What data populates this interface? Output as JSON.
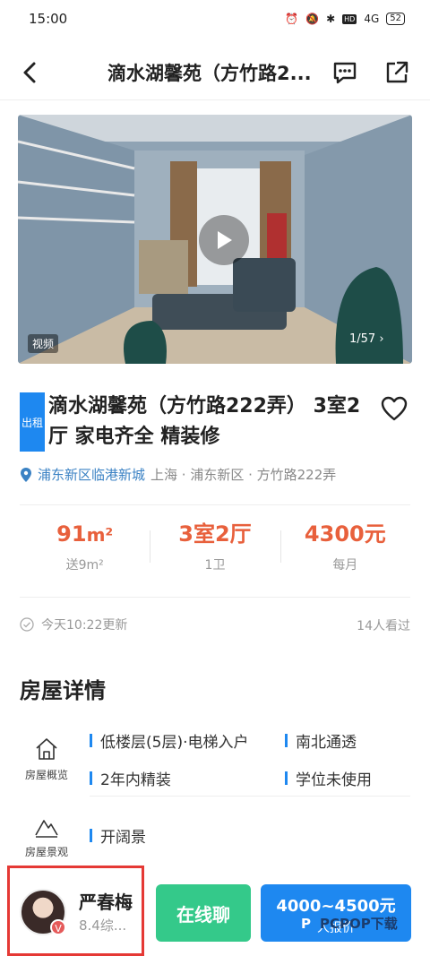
{
  "status_bar": {
    "time": "15:00",
    "network": "4G",
    "hd": "HD",
    "battery": "52"
  },
  "nav": {
    "title": "滴水湖馨苑（方竹路2..."
  },
  "media": {
    "video_tag": "视频",
    "counter": "1/57"
  },
  "listing": {
    "badge": "出租",
    "title": "滴水湖馨苑（方竹路222弄） 3室2厅 家电齐全 精装修",
    "district": "浦东新区临港新城",
    "address": "上海 · 浦东新区 · 方竹路222弄"
  },
  "stats": [
    {
      "value": "91",
      "unit": "m²",
      "sub": "送9m²"
    },
    {
      "value": "3室2厅",
      "unit": "",
      "sub": "1卫"
    },
    {
      "value": "4300元",
      "unit": "",
      "sub": "每月"
    }
  ],
  "update": {
    "text": "今天10:22更新",
    "views": "14人看过"
  },
  "details": {
    "section_title": "房屋详情",
    "overview_label": "房屋概览",
    "overview_items": [
      "低楼层(5层)·电梯入户",
      "南北通透",
      "2年内精装",
      "学位未使用"
    ],
    "view_label": "房屋景观",
    "view_items": [
      "开阔景"
    ]
  },
  "agent": {
    "name": "严春梅",
    "score": "8.4综...",
    "badge": "V"
  },
  "buttons": {
    "chat": "在线聊",
    "quote_price": "4000~4500元",
    "quote_label": "人报价"
  },
  "watermark": {
    "logo": "P",
    "text": "PCPOP下载"
  },
  "colors": {
    "accent_blue": "#1e88f0",
    "price_orange": "#e8603c",
    "chat_green": "#34c98a",
    "highlight_red": "#e53935"
  }
}
